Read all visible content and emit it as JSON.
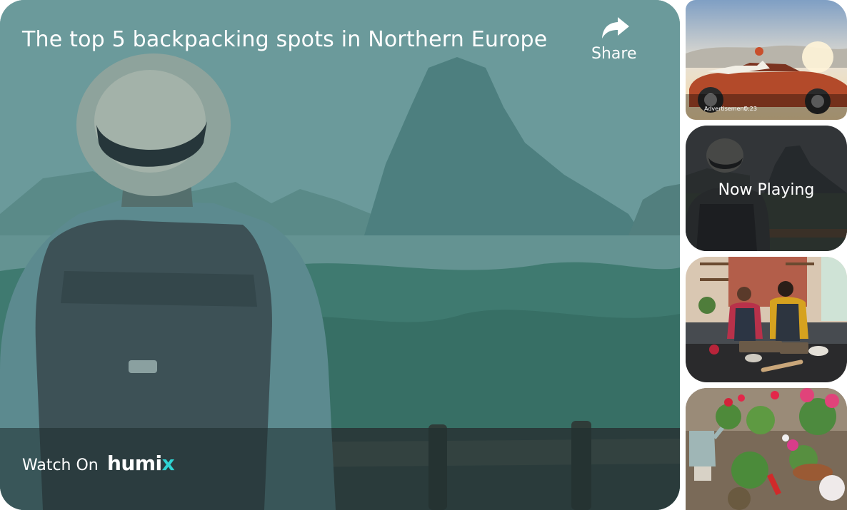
{
  "video": {
    "title": "The top 5 backpacking spots in Northern Europe",
    "share_label": "Share",
    "watch_on_label": "Watch On",
    "brand_name_main": "humi",
    "brand_name_accent": "x"
  },
  "playlist": {
    "ad_label": "Advertisement",
    "ad_time": "0:23",
    "now_playing_label": "Now Playing"
  },
  "colors": {
    "overlay_tint": "#5f9192",
    "brand_accent": "#2fd3d3",
    "text": "#ffffff"
  },
  "icons": [
    "share-arrow-icon"
  ]
}
